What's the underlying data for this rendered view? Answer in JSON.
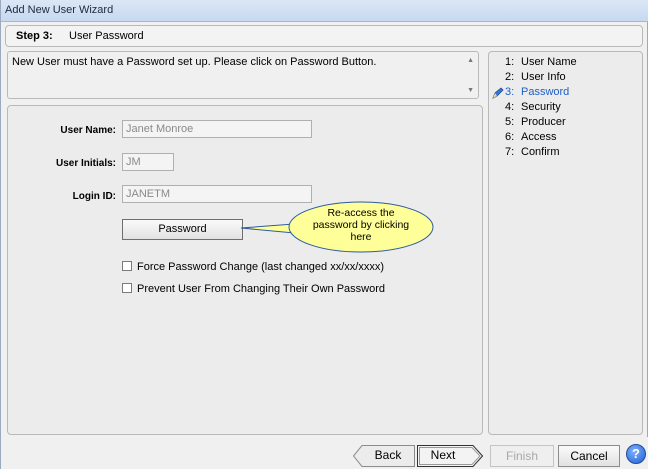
{
  "window": {
    "title": "Add New User Wizard"
  },
  "step_header": {
    "step_label": "Step 3:",
    "step_title": "User Password"
  },
  "message": {
    "text": "New User must have a Password set up.   Please click on Password Button."
  },
  "form": {
    "user_name_label": "User Name:",
    "user_name_value": "Janet Monroe",
    "user_initials_label": "User Initials:",
    "user_initials_value": "JM",
    "login_id_label": "Login ID:",
    "login_id_value": "JANETM",
    "password_button_label": "Password",
    "force_change_label": "Force Password Change (last changed xx/xx/xxxx)",
    "prevent_change_label": "Prevent User From Changing Their Own Password"
  },
  "callout": {
    "text": "Re-access the password by clicking here",
    "fill": "#ffff99"
  },
  "steps": [
    {
      "num": "1:",
      "label": "User Name"
    },
    {
      "num": "2:",
      "label": "User Info"
    },
    {
      "num": "3:",
      "label": "Password"
    },
    {
      "num": "4:",
      "label": "Security"
    },
    {
      "num": "5:",
      "label": "Producer"
    },
    {
      "num": "6:",
      "label": "Access"
    },
    {
      "num": "7:",
      "label": "Confirm"
    }
  ],
  "nav": {
    "back_label": "Back",
    "next_label": "Next",
    "finish_label": "Finish",
    "cancel_label": "Cancel",
    "help_label": "?"
  },
  "colors": {
    "active_step": "#1f5fc8"
  }
}
